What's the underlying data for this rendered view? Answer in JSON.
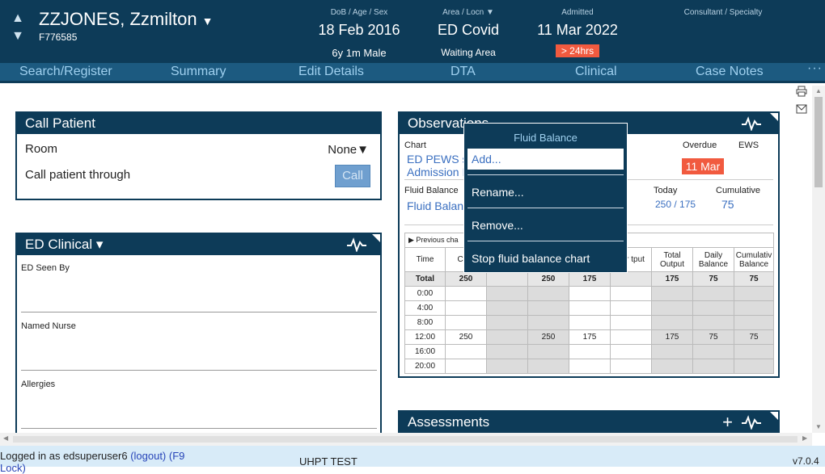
{
  "patient": {
    "name": "ZZJONES, Zzmilton",
    "id": "F776585",
    "dob_label": "DoB / Age / Sex",
    "dob": "18 Feb 2016",
    "age_sex": "6y 1m Male",
    "area_label": "Area / Locn",
    "area": "ED Covid",
    "location": "Waiting Area",
    "admitted_label": "Admitted",
    "admitted": "11 Mar 2022",
    "los_badge": "> 24hrs",
    "consultant_label": "Consultant / Specialty"
  },
  "nav": {
    "tabs": [
      "Search/Register",
      "Summary",
      "Edit Details",
      "DTA",
      "Clinical",
      "Case Notes"
    ],
    "more": "···"
  },
  "call_patient": {
    "title": "Call Patient",
    "room_label": "Room",
    "room_value": "None▼",
    "call_through_label": "Call patient through",
    "call_button": "Call"
  },
  "ed_clinical": {
    "title": "ED Clinical ▾",
    "fields": [
      "ED Seen By",
      "Named Nurse",
      "Allergies"
    ]
  },
  "observations": {
    "title": "Observations",
    "chart_label": "Chart",
    "chart_links": [
      "ED PEWS s",
      "Admission I"
    ],
    "overdue_label": "Overdue",
    "overdue_value": "11 Mar",
    "ews_label": "EWS",
    "fluid_balance_label": "Fluid Balance",
    "fluid_balance_link": "Fluid Balan",
    "today_label": "Today",
    "today_value": "250 / 175",
    "cumulative_label": "Cumulative",
    "cumulative_value": "75",
    "previous_chart": "▶ Previous cha",
    "table": {
      "headers": [
        "Time",
        "C Int",
        "",
        "",
        "",
        "her tput",
        "Total Output",
        "Daily Balance",
        "Cumulativ Balance"
      ],
      "rows": [
        [
          "Total",
          "250",
          "",
          "250",
          "175",
          "",
          "175",
          "75",
          "75"
        ],
        [
          "0:00",
          "",
          "",
          "",
          "",
          "",
          "",
          "",
          ""
        ],
        [
          "4:00",
          "",
          "",
          "",
          "",
          "",
          "",
          "",
          ""
        ],
        [
          "8:00",
          "",
          "",
          "",
          "",
          "",
          "",
          "",
          ""
        ],
        [
          "12:00",
          "250",
          "",
          "250",
          "175",
          "",
          "175",
          "75",
          "75"
        ],
        [
          "16:00",
          "",
          "",
          "",
          "",
          "",
          "",
          "",
          ""
        ],
        [
          "20:00",
          "",
          "",
          "",
          "",
          "",
          "",
          "",
          ""
        ]
      ]
    }
  },
  "assessments": {
    "title": "Assessments",
    "add": "+"
  },
  "context_menu": {
    "title": "Fluid Balance",
    "items": [
      "Add...",
      "Rename...",
      "Remove...",
      "Stop fluid balance chart"
    ]
  },
  "footer": {
    "logged_in": "Logged in as edsuperuser6",
    "logout": "(logout)",
    "lock": "(F9 Lock)",
    "environment": "UHPT TEST",
    "version": "v7.0.4"
  },
  "colors": {
    "header_bg": "#0d3b58",
    "nav_bg": "#1c5a80",
    "alert": "#f15a3f",
    "link": "#3a6fc0"
  }
}
